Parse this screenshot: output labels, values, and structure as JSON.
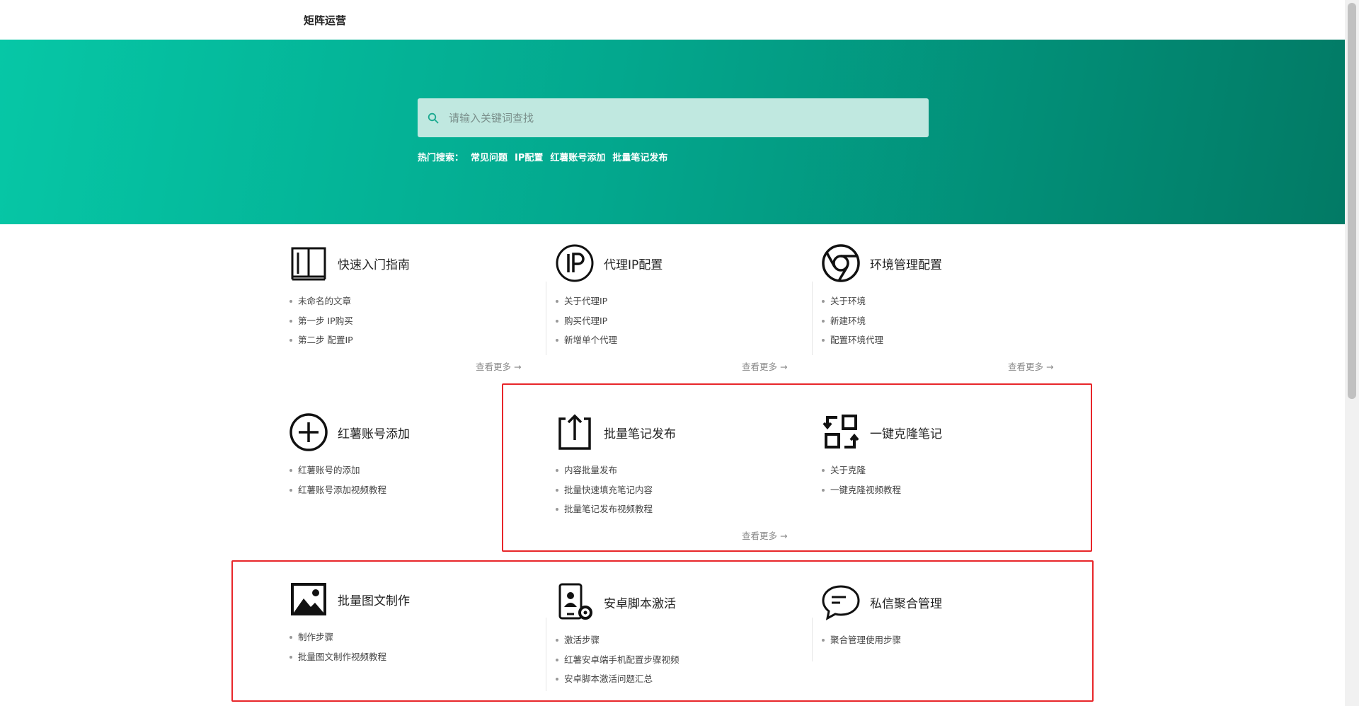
{
  "brand": "矩阵运营",
  "search": {
    "placeholder": "请输入关键词查找"
  },
  "hot": {
    "label": "热门搜索：",
    "items": [
      "常见问题",
      "IP配置",
      "红薯账号添加",
      "批量笔记发布"
    ]
  },
  "more_label": "查看更多 →",
  "cards": [
    {
      "title": "快速入门指南",
      "icon": "book-icon",
      "items": [
        "未命名的文章",
        "第一步 IP购买",
        "第二步 配置IP"
      ]
    },
    {
      "title": "代理IP配置",
      "icon": "ip-icon",
      "items": [
        "关于代理IP",
        "购买代理IP",
        "新增单个代理"
      ]
    },
    {
      "title": "环境管理配置",
      "icon": "chrome-icon",
      "items": [
        "关于环境",
        "新建环境",
        "配置环境代理"
      ]
    },
    {
      "title": "红薯账号添加",
      "icon": "plus-circle-icon",
      "items": [
        "红薯账号的添加",
        "红薯账号添加视频教程"
      ]
    },
    {
      "title": "批量笔记发布",
      "icon": "upload-icon",
      "items": [
        "内容批量发布",
        "批量快速填充笔记内容",
        "批量笔记发布视频教程"
      ]
    },
    {
      "title": "一键克隆笔记",
      "icon": "clone-icon",
      "items": [
        "关于克隆",
        "一键克隆视频教程"
      ]
    },
    {
      "title": "批量图文制作",
      "icon": "image-icon",
      "items": [
        "制作步骤",
        "批量图文制作视频教程"
      ]
    },
    {
      "title": "安卓脚本激活",
      "icon": "phone-settings-icon",
      "items": [
        "激活步骤",
        "红薯安卓端手机配置步骤视频",
        "安卓脚本激活问题汇总"
      ]
    },
    {
      "title": "私信聚合管理",
      "icon": "chat-bubble-icon",
      "items": [
        "聚合管理使用步骤"
      ]
    }
  ],
  "colors": {
    "accent": "#03a88e",
    "highlight_border": "#e8262a"
  }
}
